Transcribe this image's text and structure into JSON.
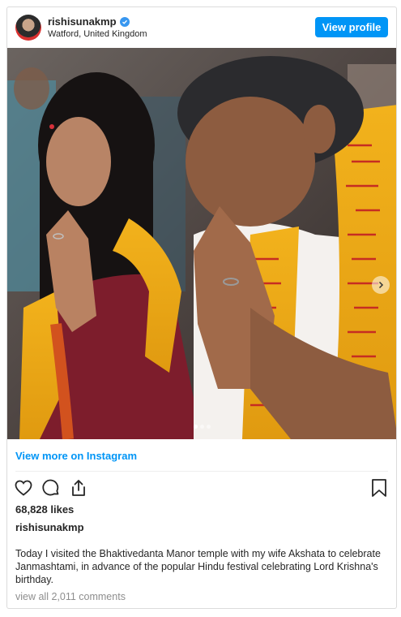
{
  "post": {
    "username": "rishisunakmp",
    "location": "Watford, United Kingdom",
    "view_profile_label": "View profile",
    "view_more_label": "View more on Instagram",
    "likes": "68,828 likes",
    "caption_username": "rishisunakmp",
    "caption_text": "Today I visited the Bhaktivedanta Manor temple with my wife Akshata to celebrate Janmashtami, in advance of the popular Hindu festival celebrating Lord Krishna's birthday.",
    "comments_link": "view all 2,011 comments",
    "carousel_count": 3,
    "carousel_active": 0
  },
  "icons": {
    "verified": "verified-badge-icon",
    "like": "heart-icon",
    "comment": "comment-icon",
    "share": "share-icon",
    "save": "bookmark-icon",
    "next": "chevron-right-icon"
  },
  "colors": {
    "accent": "#0095f6",
    "text": "#262626",
    "muted": "#8e8e8e",
    "border": "#dbdbdb"
  }
}
